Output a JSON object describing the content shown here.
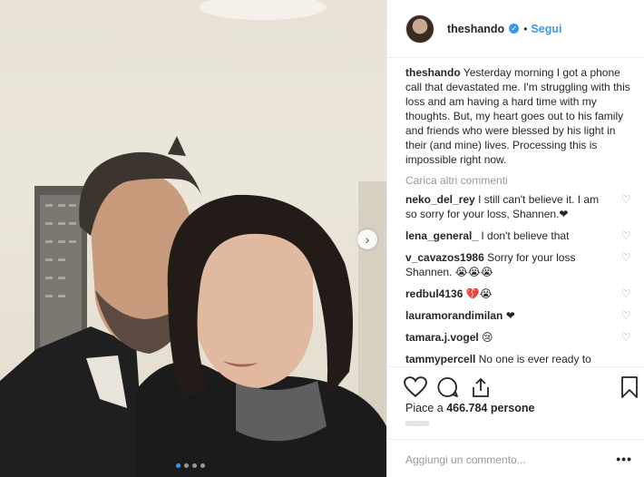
{
  "header": {
    "username": "theshando",
    "separator": "•",
    "follow_label": "Segui"
  },
  "caption": {
    "username": "theshando",
    "text": "Yesterday morning I got a phone call that devastated me. I'm struggling with this loss and am having a hard time with my thoughts. But, my heart goes out to his family and friends who were blessed by his light in their (and mine) lives. Processing this is impossible right now."
  },
  "load_more_label": "Carica altri commenti",
  "comments": [
    {
      "username": "neko_del_rey",
      "text": "I still can't believe it. I am so sorry for your loss, Shannen.❤"
    },
    {
      "username": "lena_general_",
      "text": "I don't believe that"
    },
    {
      "username": "v_cavazos1986",
      "text": "Sorry for your loss Shannen. 😭😭😭"
    },
    {
      "username": "redbul4136",
      "text": "💔😭"
    },
    {
      "username": "lauramorandimilan",
      "text": "❤"
    },
    {
      "username": "tamara.j.vogel",
      "text": "😢"
    },
    {
      "username": "tammypercell",
      "text": "No one is ever ready to receive that phone call. He will be"
    }
  ],
  "likes": {
    "prefix": "Piace a",
    "count": "466.784",
    "suffix": "persone"
  },
  "add_comment_placeholder": "Aggiungi un commento...",
  "more_options": "•••",
  "carousel": {
    "current_index": 1,
    "total": 4
  },
  "icons": [
    "verified-badge-icon",
    "heart-icon",
    "comment-icon",
    "share-icon",
    "bookmark-icon",
    "chevron-right-icon",
    "options-icon"
  ],
  "colors": {
    "accent": "#3897f0",
    "text": "#262626",
    "muted": "#999999",
    "border": "#efefef"
  }
}
